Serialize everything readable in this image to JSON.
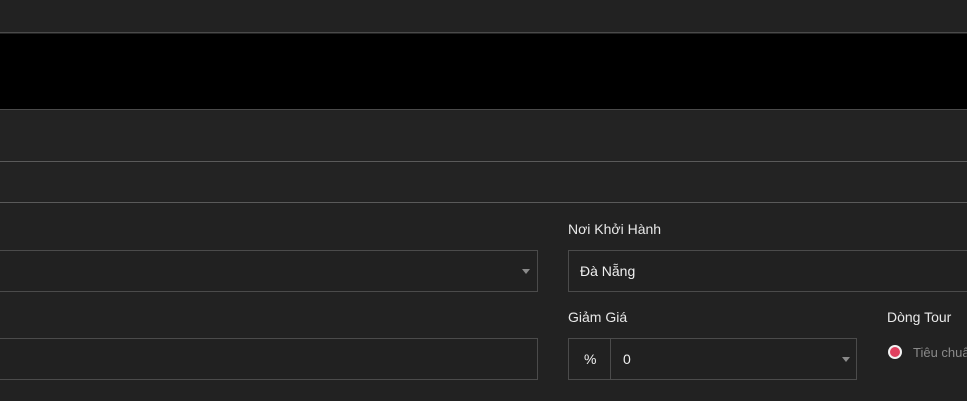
{
  "form": {
    "departure": {
      "label": "Nơi Khởi Hành",
      "value": "Đà Nẵng"
    },
    "discount": {
      "label": "Giảm Giá",
      "unit": "%",
      "value": "0"
    },
    "tour_line": {
      "label": "Dòng Tour",
      "option_label": "Tiêu chuẩn"
    }
  },
  "colors": {
    "background": "#222222",
    "header_band": "#000000",
    "radio_accent": "#e0405f"
  }
}
